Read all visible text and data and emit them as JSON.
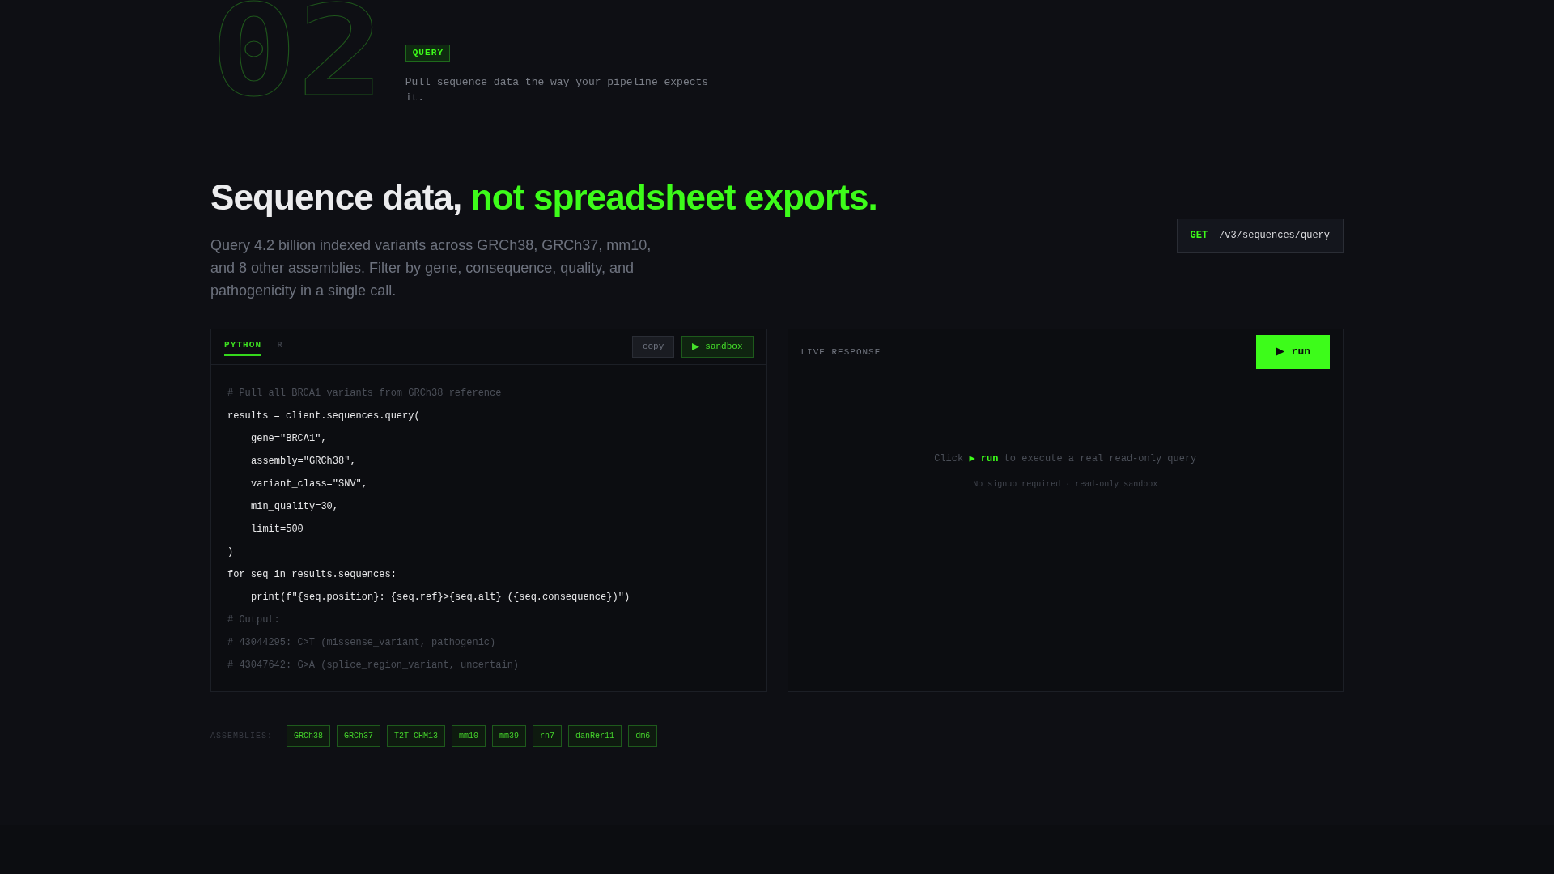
{
  "section": {
    "number": "02",
    "badge": "QUERY",
    "description": "Pull sequence data the way your pipeline expects it."
  },
  "heading": {
    "text": "Sequence data,",
    "highlight": "not spreadsheet exports."
  },
  "intro": "Query 4.2 billion indexed variants across GRCh38, GRCh37, mm10, and 8 other assemblies. Filter by gene, consequence, quality, and pathogenicity in a single call.",
  "endpoint": {
    "method": "GET",
    "path": "/v3/sequences/query"
  },
  "code_panel": {
    "tabs": [
      {
        "label": "PYTHON",
        "selected": true
      },
      {
        "label": "R",
        "selected": false
      }
    ],
    "buttons": [
      {
        "label": "copy",
        "kind": "plain"
      },
      {
        "label": "sandbox",
        "kind": "play"
      }
    ],
    "lines": [
      {
        "kind": "comment",
        "text": "# Pull all BRCA1 variants from GRCh38 reference"
      },
      {
        "kind": "code",
        "text": "results = client.sequences.query(",
        "children": [
          {
            "kind": "code",
            "text": "gene=\"BRCA1\","
          },
          {
            "kind": "code",
            "text": "assembly=\"GRCh38\","
          },
          {
            "kind": "code",
            "text": "variant_class=\"SNV\","
          },
          {
            "kind": "code",
            "text": "min_quality=30,"
          },
          {
            "kind": "code",
            "text": "limit=500"
          }
        ]
      },
      {
        "kind": "code",
        "text": ")"
      },
      {
        "kind": "code",
        "text": "for seq in results.sequences:",
        "children": [
          {
            "kind": "code",
            "text": "print(f\"{seq.position}: {seq.ref}>{seq.alt} ({seq.consequence})\")"
          }
        ]
      },
      {
        "kind": "comment",
        "text": "# Output:"
      },
      {
        "kind": "comment",
        "text": "# 43044295: C>T (missense_variant, pathogenic)"
      },
      {
        "kind": "comment",
        "text": "# 43047642: G>A (splice_region_variant, uncertain)"
      }
    ]
  },
  "response_panel": {
    "title": "LIVE RESPONSE",
    "run_button": "run",
    "hint": {
      "before": "Click",
      "action": "▶ run",
      "after": "to execute a real read-only query"
    },
    "note": "No signup required · read-only sandbox"
  },
  "assemblies": {
    "label": "ASSEMBLIES:",
    "tags": [
      "GRCh38",
      "GRCh37",
      "T2T-CHM13",
      "mm10",
      "mm39",
      "rn7",
      "danRer11",
      "dm6"
    ]
  }
}
